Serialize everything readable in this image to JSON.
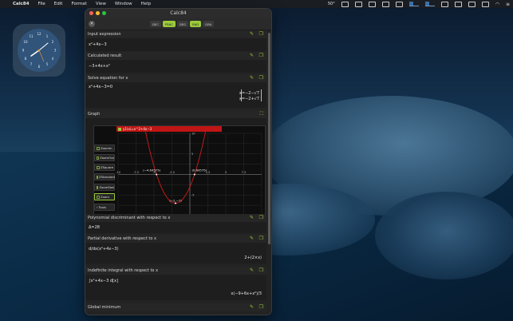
{
  "menubar": {
    "app_name": "Calc84",
    "items": [
      "File",
      "Edit",
      "Format",
      "View",
      "Window",
      "Help"
    ],
    "temperature": "50°"
  },
  "window": {
    "title": "Calc84",
    "modes": [
      "DEC",
      "FRAC",
      "DEG",
      "RAD",
      "GRA"
    ],
    "active_modes": [
      "FRAC",
      "RAD"
    ]
  },
  "sections": {
    "input": {
      "title": "Input expression",
      "expr": "x²+4x−3"
    },
    "calculated": {
      "title": "Calculated result",
      "expr": "−3+4x+x²"
    },
    "solve": {
      "title": "Solve equation for x",
      "expr": "x²+4x−3=0",
      "result1": "x=−2−√7",
      "result2": "x=−2+√7"
    },
    "graph": {
      "title": "Graph",
      "legend": "y1(x)=x^2+4x−3",
      "tools": [
        "ZoomIn",
        "ZoomOut",
        "ZSquare",
        "ZStandard",
        "ZoomStat",
        "Zoom",
        "Tools"
      ],
      "annotations": {
        "root_left": "(−4.64575)",
        "root_right": "(0.64575)",
        "vertex": "(−2,−7)"
      }
    },
    "discriminant": {
      "title": "Polynomial discriminant with respect to x",
      "expr": "Δ=28"
    },
    "partial": {
      "title": "Partial derivative with respect to x",
      "expr": "d/dx(x²+4x−3)",
      "result": "2+(2×x)"
    },
    "integral": {
      "title": "Indefinite integral with respect to x",
      "expr": "∫x²+4x−3 d[x]",
      "result": "x(−9+6x+x²)/3"
    },
    "global_min": {
      "title": "Global minimum"
    }
  },
  "chart_data": {
    "type": "line",
    "title": "",
    "xlabel": "",
    "ylabel": "",
    "xlim": [
      -10,
      10
    ],
    "ylim": [
      -10,
      10
    ],
    "x_ticks": [
      -10,
      -7.5,
      -5,
      -2.5,
      2.5,
      5,
      7.5
    ],
    "y_ticks": [
      -10,
      -5,
      5,
      10
    ],
    "series": [
      {
        "name": "y1(x)=x^2+4x−3",
        "expression": "x^2+4x-3",
        "color": "#d11a1a"
      }
    ],
    "points": [
      {
        "label": "(−4.64575)",
        "x": -4.64575,
        "y": 0
      },
      {
        "label": "(0.64575)",
        "x": 0.64575,
        "y": 0
      },
      {
        "label": "(−2,−7)",
        "x": -2,
        "y": -7
      }
    ],
    "grid": true
  },
  "colors": {
    "accent": "#9bc93b",
    "curve": "#d11a1a",
    "legend_bg": "#c01515"
  }
}
